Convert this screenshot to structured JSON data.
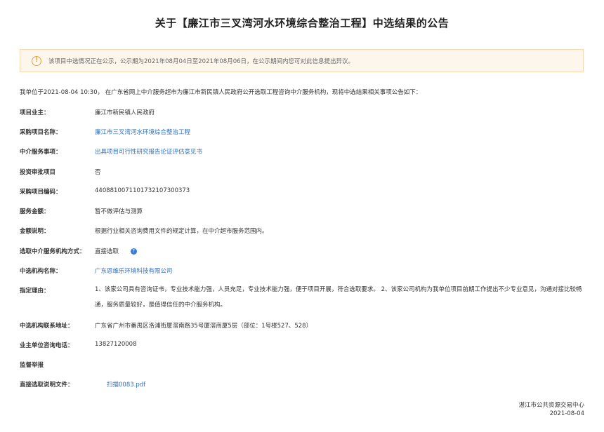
{
  "title": "关于【廉江市三叉湾河水环境综合整治工程】中选结果的公告",
  "notice": {
    "icon": "exclamation-circle-icon",
    "text": "该项目中选情况正在公示，公示期为2021年08月04日至2021年08月06日，在公示期间内您可对此信息提出异议。"
  },
  "intro": "我单位于2021-08-04 10:30， 在广东省网上中介服务超市为廉江市新民镇人民政府公开选取工程咨询中介服务机构，现将中选结果相关事项公告如下：",
  "fields": {
    "owner": {
      "label": "项目业主：",
      "value": "廉江市新民镇人民政府"
    },
    "project_name": {
      "label": "采购项目名称：",
      "value": "廉江市三叉湾河水环境综合整治工程"
    },
    "service_item": {
      "label": "中介服务事项：",
      "value": "出具项目可行性研究报告论证评估意见书"
    },
    "investment_review": {
      "label": "投资审批项目",
      "value": "否"
    },
    "project_code": {
      "label": "采购项目编码：",
      "value": "440881007110173210730037​3"
    },
    "amount": {
      "label": "服务金额：",
      "value": "暂不做评估与测算"
    },
    "amount_note": {
      "label": "金额说明：",
      "value": "根据行业相关咨询费用文件的规定计算，在中介超市服务范围内。"
    },
    "selection_method": {
      "label": "选取中介服务机构方式：",
      "value": "直接选取"
    },
    "winner": {
      "label": "中选机构名称：",
      "value": "广东恩维乐环境科技有限公司"
    },
    "reason": {
      "label": "指定理由：",
      "value": "1、该家公司具有咨询证书，专业技术能力强，人员充足，专业技术能力强，便于项目开展，符合选取要求。 2、该家公司机构为我单位项目前期工作提出不少专业意见，沟通对接比较畅通，服务质量较好，是值得信任的中介服务机构。"
    },
    "winner_address": {
      "label": "中选机构联系地址：",
      "value": "广东省广州市番禺区洛浦街厦滘南路35号厦滘商厦5层（部位：1号楼527、528）"
    },
    "owner_phone": {
      "label": "业主单位咨询电话：",
      "value": "13827120008"
    },
    "supervision": {
      "label": "监督举报"
    },
    "attachment": {
      "label": "直接选取说明文件：",
      "value": "扫描0083.pdf"
    }
  },
  "footer": {
    "org": "湛江市公共资源交易中心",
    "date": "2021-08-04"
  }
}
